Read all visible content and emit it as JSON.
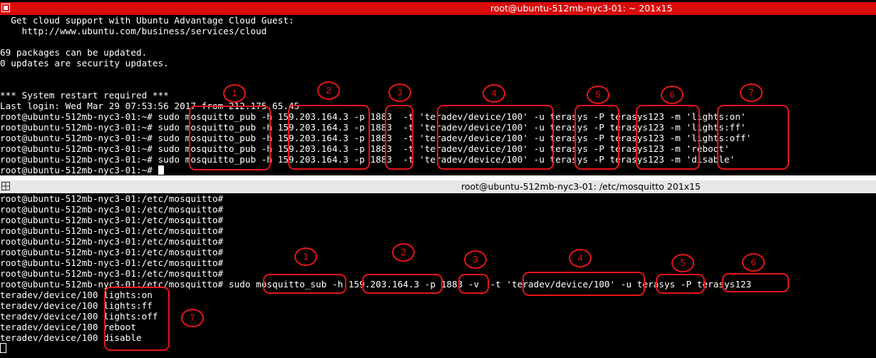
{
  "window1": {
    "title": "root@ubuntu-512mb-nyc3-01: ~ 201x15",
    "lines": [
      "  Get cloud support with Ubuntu Advantage Cloud Guest:",
      "    http://www.ubuntu.com/business/services/cloud",
      "",
      "69 packages can be updated.",
      "0 updates are security updates.",
      "",
      "",
      "*** System restart required ***",
      "Last login: Wed Mar 29 07:53:56 2017 from 212.175.65.45",
      "root@ubuntu-512mb-nyc3-01:~# sudo mosquitto_pub -h 159.203.164.3 -p 1883  -t 'teradev/device/100' -u terasys -P terasys123 -m 'lights:on'",
      "root@ubuntu-512mb-nyc3-01:~# sudo mosquitto_pub -h 159.203.164.3 -p 1883  -t 'teradev/device/100' -u terasys -P terasys123 -m 'lights:ff'",
      "root@ubuntu-512mb-nyc3-01:~# sudo mosquitto_pub -h 159.203.164.3 -p 1883  -t 'teradev/device/100' -u terasys -P terasys123 -m 'lights:off'",
      "root@ubuntu-512mb-nyc3-01:~# sudo mosquitto_pub -h 159.203.164.3 -p 1883  -t 'teradev/device/100' -u terasys -P terasys123 -m 'reboot'",
      "root@ubuntu-512mb-nyc3-01:~# sudo mosquitto_pub -h 159.203.164.3 -p 1883  -t 'teradev/device/100' -u terasys -P terasys123 -m 'disable'"
    ],
    "prompt": "root@ubuntu-512mb-nyc3-01:~# "
  },
  "window2": {
    "title": "root@ubuntu-512mb-nyc3-01: /etc/mosquitto 201x15",
    "lines": [
      "root@ubuntu-512mb-nyc3-01:/etc/mosquitto#",
      "root@ubuntu-512mb-nyc3-01:/etc/mosquitto#",
      "root@ubuntu-512mb-nyc3-01:/etc/mosquitto#",
      "root@ubuntu-512mb-nyc3-01:/etc/mosquitto#",
      "root@ubuntu-512mb-nyc3-01:/etc/mosquitto#",
      "root@ubuntu-512mb-nyc3-01:/etc/mosquitto#",
      "root@ubuntu-512mb-nyc3-01:/etc/mosquitto#",
      "root@ubuntu-512mb-nyc3-01:/etc/mosquitto#",
      "root@ubuntu-512mb-nyc3-01:/etc/mosquitto# sudo mosquitto_sub -h 159.203.164.3 -p 1883 -v  -t 'teradev/device/100' -u terasys -P terasys123",
      "teradev/device/100 lights:on",
      "teradev/device/100 lights:ff",
      "teradev/device/100 lights:off",
      "teradev/device/100 reboot",
      "teradev/device/100 disable"
    ]
  },
  "annotations": {
    "window1": [
      "1",
      "2",
      "3",
      "4",
      "5",
      "6",
      "7"
    ],
    "window2": [
      "1",
      "2",
      "3",
      "4",
      "5",
      "6",
      "7"
    ]
  },
  "colors": {
    "titlebar_active": "#d90b0b",
    "titlebar_inactive": "#e7e7e7",
    "annotation": "#e8141a"
  }
}
